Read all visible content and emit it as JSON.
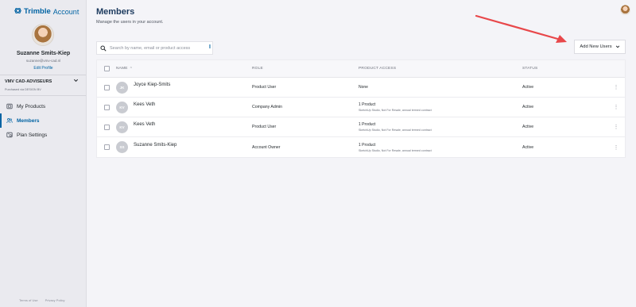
{
  "sidebar": {
    "brand": "Trimble",
    "account_label": "Account",
    "user_name": "Suzanne Smits-Kiep",
    "user_email": "suzanne@vmv-cad.nl",
    "edit_profile": "Edit Profile",
    "org_name": "VMV CAD-ADVISEURS",
    "org_sub": "Purchased via DESIGN BV",
    "nav": [
      {
        "label": "My Products",
        "icon": "products-icon"
      },
      {
        "label": "Members",
        "icon": "members-icon",
        "active": true
      },
      {
        "label": "Plan Settings",
        "icon": "settings-icon"
      }
    ],
    "footer": {
      "terms": "Terms of Use",
      "privacy": "Privacy Policy"
    }
  },
  "main": {
    "title": "Members",
    "subtitle": "Manage the users in your account.",
    "search_placeholder": "Search by name, email or product access",
    "add_button": "Add New Users"
  },
  "table": {
    "columns": [
      "NAME",
      "ROLE",
      "PRODUCT ACCESS",
      "STATUS"
    ],
    "rows": [
      {
        "initials": "JK",
        "name": "Joyce Kiep-Smits",
        "role": "Product User",
        "access": "None",
        "access_detail": "",
        "status": "Active"
      },
      {
        "initials": "KV",
        "name": "Kees Veth",
        "role": "Company Admin",
        "access": "1 Product",
        "access_detail": "SketchUp Studio, Not For Resale, annual termed contract",
        "status": "Active"
      },
      {
        "initials": "KV",
        "name": "Kees Veth",
        "role": "Product User",
        "access": "1 Product",
        "access_detail": "SketchUp Studio, Not For Resale, annual termed contract",
        "status": "Active"
      },
      {
        "initials": "SS",
        "name": "Suzanne Smits-Kiep",
        "role": "Account Owner",
        "access": "1 Product",
        "access_detail": "SketchUp Studio, Not For Resale, annual termed contract",
        "status": "Active"
      }
    ]
  },
  "colors": {
    "accent": "#0063a3",
    "annotation_arrow": "#e8474a"
  }
}
